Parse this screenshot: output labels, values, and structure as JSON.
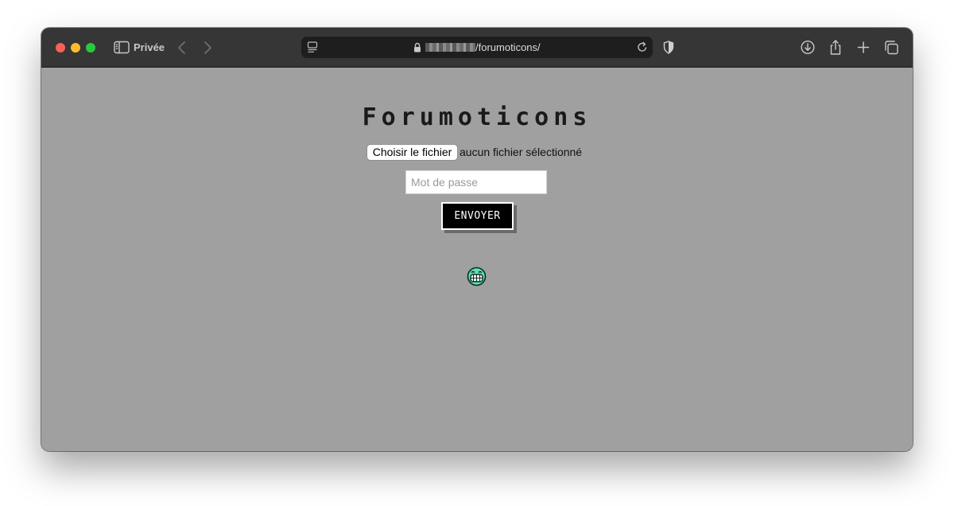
{
  "browser": {
    "private_label": "Privée",
    "url_path": "/forumoticons/"
  },
  "page": {
    "title": "Forumoticons",
    "file_button_label": "Choisir le fichier",
    "file_status": "aucun fichier sélectionné",
    "password_placeholder": "Mot de passe",
    "submit_label": "ENVOYER"
  },
  "icons": {
    "window_controls": [
      "close-light",
      "minimize-light",
      "zoom-light"
    ],
    "toolbar": [
      "sidebar-icon",
      "back-icon",
      "forward-icon",
      "page-menu-icon",
      "lock-icon",
      "reload-icon",
      "shield-icon",
      "download-icon",
      "share-icon",
      "new-tab-icon",
      "tab-overview-icon"
    ],
    "content": [
      "grinning-emoticon-icon"
    ]
  },
  "colors": {
    "traffic_red": "#ff5f57",
    "traffic_yellow": "#febc2e",
    "traffic_green": "#28c840",
    "toolbar_bg": "#363636",
    "page_bg": "#a0a0a0",
    "emoticon_green": "#5fe0b0"
  }
}
